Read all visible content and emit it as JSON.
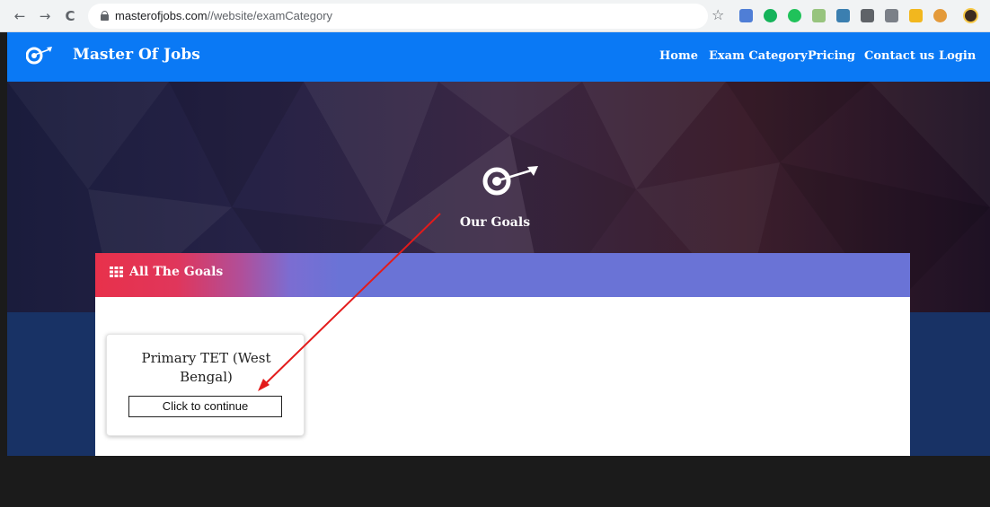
{
  "browser": {
    "back_icon": "←",
    "forward_icon": "→",
    "reload_icon": "C",
    "url_host": "masterofjobs.com",
    "url_path": "//website/examCategory",
    "star_icon": "☆"
  },
  "header": {
    "brand": "Master Of Jobs",
    "nav": [
      "Home",
      "Exam Category",
      "Pricing",
      "Contact us",
      "Login"
    ],
    "color": "#0a79f5"
  },
  "hero": {
    "title": "Our Goals"
  },
  "panel": {
    "title": "All The Goals",
    "accent_start": "#e8314b",
    "accent_end": "#6a73d6"
  },
  "goals": [
    {
      "title": "Primary TET (West Bengal)",
      "button": "Click to continue"
    }
  ],
  "annotation": {
    "color": "#e31b1b"
  }
}
